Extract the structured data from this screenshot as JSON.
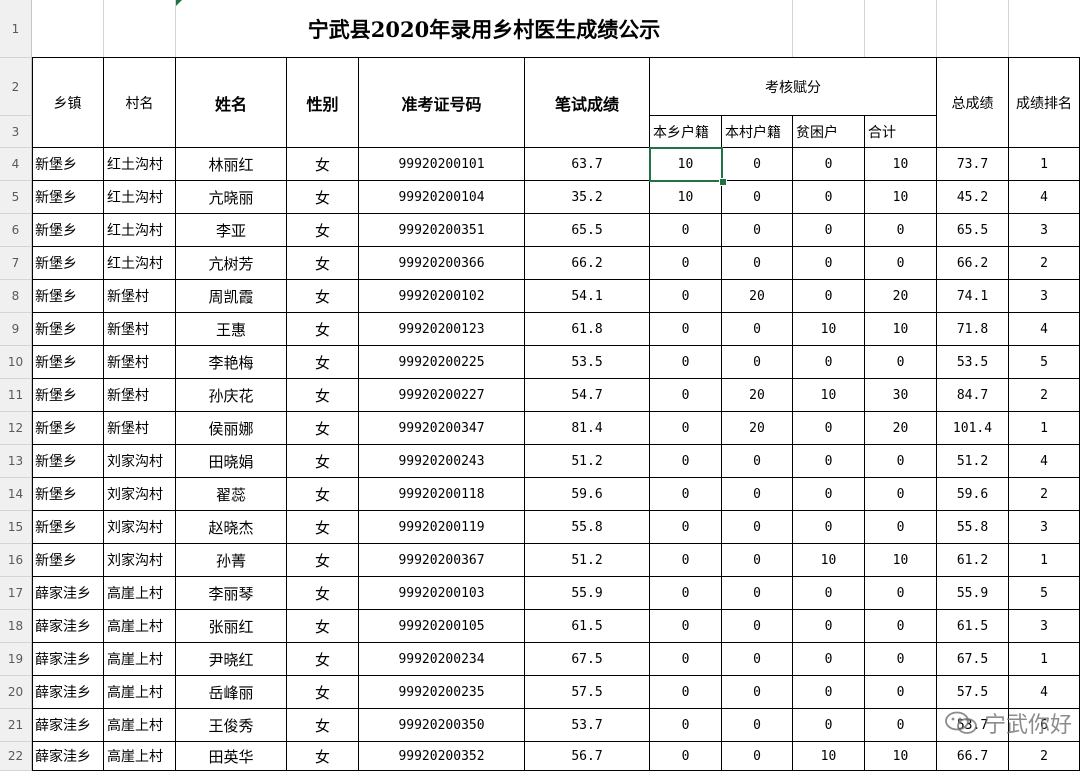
{
  "title": "宁武县2020年录用乡村医生成绩公示",
  "headers": {
    "township": "乡镇",
    "village": "村名",
    "name": "姓名",
    "gender": "性别",
    "exam_no": "准考证号码",
    "written": "笔试成绩",
    "assessment": "考核赋分",
    "sub": [
      "本乡户籍",
      "本村户籍",
      "贫困户",
      "合计"
    ],
    "total": "总成绩",
    "rank": "成绩排名"
  },
  "row_numbers": [
    "1",
    "2",
    "3",
    "4",
    "5",
    "6",
    "7",
    "8",
    "9",
    "10",
    "11",
    "12",
    "13",
    "14",
    "15",
    "16",
    "17",
    "18",
    "19",
    "20",
    "21",
    "22"
  ],
  "rows": [
    [
      "新堡乡",
      "红土沟村",
      "林丽红",
      "女",
      "99920200101",
      "63.7",
      "10",
      "0",
      "0",
      "10",
      "73.7",
      "1"
    ],
    [
      "新堡乡",
      "红土沟村",
      "亢晓丽",
      "女",
      "99920200104",
      "35.2",
      "10",
      "0",
      "0",
      "10",
      "45.2",
      "4"
    ],
    [
      "新堡乡",
      "红土沟村",
      "李亚",
      "女",
      "99920200351",
      "65.5",
      "0",
      "0",
      "0",
      "0",
      "65.5",
      "3"
    ],
    [
      "新堡乡",
      "红土沟村",
      "亢树芳",
      "女",
      "99920200366",
      "66.2",
      "0",
      "0",
      "0",
      "0",
      "66.2",
      "2"
    ],
    [
      "新堡乡",
      "新堡村",
      "周凯霞",
      "女",
      "99920200102",
      "54.1",
      "0",
      "20",
      "0",
      "20",
      "74.1",
      "3"
    ],
    [
      "新堡乡",
      "新堡村",
      "王惠",
      "女",
      "99920200123",
      "61.8",
      "0",
      "0",
      "10",
      "10",
      "71.8",
      "4"
    ],
    [
      "新堡乡",
      "新堡村",
      "李艳梅",
      "女",
      "99920200225",
      "53.5",
      "0",
      "0",
      "0",
      "0",
      "53.5",
      "5"
    ],
    [
      "新堡乡",
      "新堡村",
      "孙庆花",
      "女",
      "99920200227",
      "54.7",
      "0",
      "20",
      "10",
      "30",
      "84.7",
      "2"
    ],
    [
      "新堡乡",
      "新堡村",
      "侯丽娜",
      "女",
      "99920200347",
      "81.4",
      "0",
      "20",
      "0",
      "20",
      "101.4",
      "1"
    ],
    [
      "新堡乡",
      "刘家沟村",
      "田晓娟",
      "女",
      "99920200243",
      "51.2",
      "0",
      "0",
      "0",
      "0",
      "51.2",
      "4"
    ],
    [
      "新堡乡",
      "刘家沟村",
      "翟蕊",
      "女",
      "99920200118",
      "59.6",
      "0",
      "0",
      "0",
      "0",
      "59.6",
      "2"
    ],
    [
      "新堡乡",
      "刘家沟村",
      "赵晓杰",
      "女",
      "99920200119",
      "55.8",
      "0",
      "0",
      "0",
      "0",
      "55.8",
      "3"
    ],
    [
      "新堡乡",
      "刘家沟村",
      "孙菁",
      "女",
      "99920200367",
      "51.2",
      "0",
      "0",
      "10",
      "10",
      "61.2",
      "1"
    ],
    [
      "薛家洼乡",
      "高崖上村",
      "李丽琴",
      "女",
      "99920200103",
      "55.9",
      "0",
      "0",
      "0",
      "0",
      "55.9",
      "5"
    ],
    [
      "薛家洼乡",
      "高崖上村",
      "张丽红",
      "女",
      "99920200105",
      "61.5",
      "0",
      "0",
      "0",
      "0",
      "61.5",
      "3"
    ],
    [
      "薛家洼乡",
      "高崖上村",
      "尹晓红",
      "女",
      "99920200234",
      "67.5",
      "0",
      "0",
      "0",
      "0",
      "67.5",
      "1"
    ],
    [
      "薛家洼乡",
      "高崖上村",
      "岳峰丽",
      "女",
      "99920200235",
      "57.5",
      "0",
      "0",
      "0",
      "0",
      "57.5",
      "4"
    ],
    [
      "薛家洼乡",
      "高崖上村",
      "王俊秀",
      "女",
      "99920200350",
      "53.7",
      "0",
      "0",
      "0",
      "0",
      "53.7",
      "6"
    ],
    [
      "薛家洼乡",
      "高崖上村",
      "田英华",
      "女",
      "99920200352",
      "56.7",
      "0",
      "0",
      "10",
      "10",
      "66.7",
      "2"
    ]
  ],
  "watermark": "宁武你好",
  "watermark_icon": "wechat-icon",
  "colors": {
    "selection": "#217346",
    "header_bg": "#f0f0f0"
  }
}
